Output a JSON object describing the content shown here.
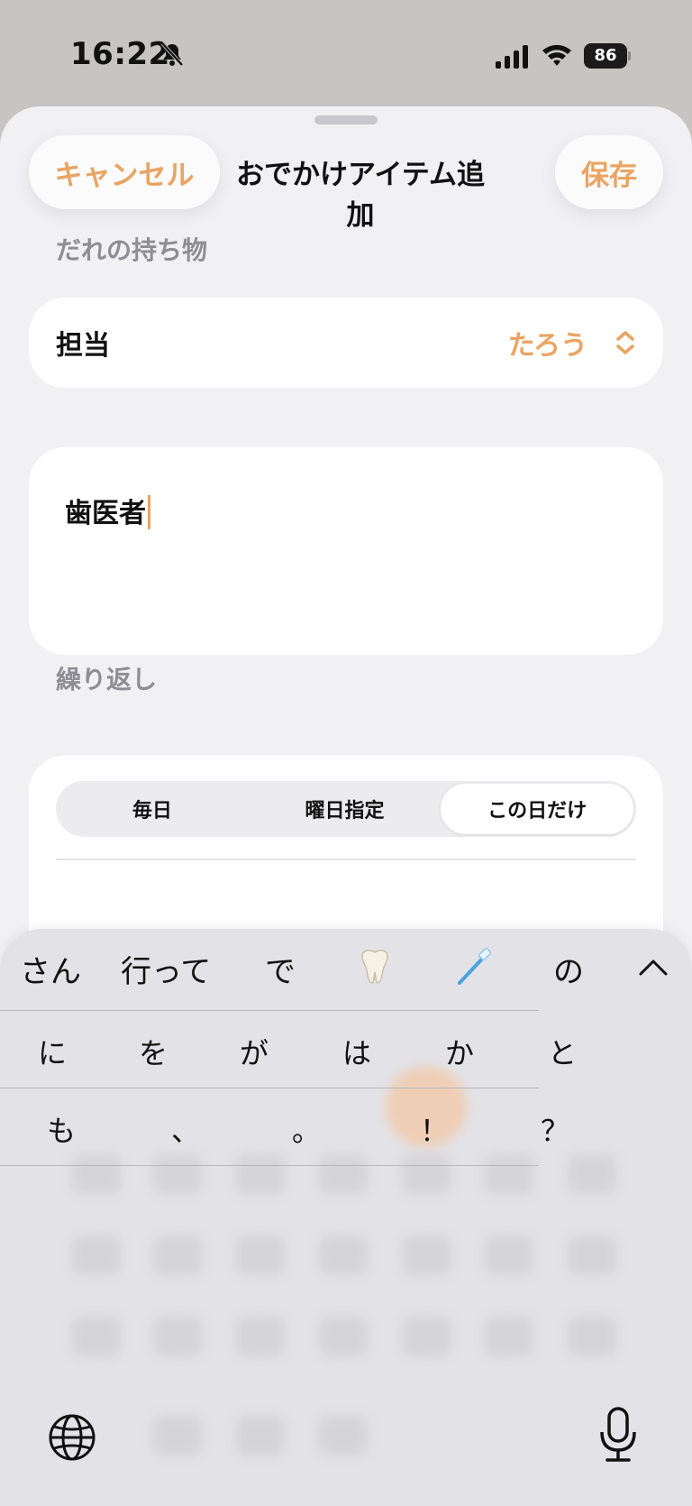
{
  "status_bar": {
    "time": "16:22",
    "battery": "86",
    "icons": [
      "bell-slash-icon",
      "signal-icon",
      "wifi-icon",
      "battery-icon"
    ]
  },
  "sheet": {
    "cancel_label": "キャンセル",
    "title": "おでかけアイテム追加",
    "save_label": "保存",
    "accent_color": "#eaa462"
  },
  "owner_section": {
    "header": "だれの持ち物",
    "field_label": "担当",
    "selected_value": "たろう",
    "selector_icon": "chevron-up-down-icon"
  },
  "item_input": {
    "value": "歯医者"
  },
  "repeat_section": {
    "header": "繰り返し",
    "options": [
      "毎日",
      "曜日指定",
      "この日だけ"
    ],
    "selected": "この日だけ"
  },
  "keyboard": {
    "candidates": [
      "さん",
      "行って",
      "で",
      "🦷",
      "🪥",
      "の"
    ],
    "prediction_rows": [
      [
        "に",
        "を",
        "が",
        "は",
        "か",
        "と"
      ],
      [
        "も",
        "、",
        "。",
        "！",
        "？"
      ]
    ],
    "icons": [
      "globe-icon",
      "microphone-icon",
      "chevron-up-icon"
    ]
  }
}
